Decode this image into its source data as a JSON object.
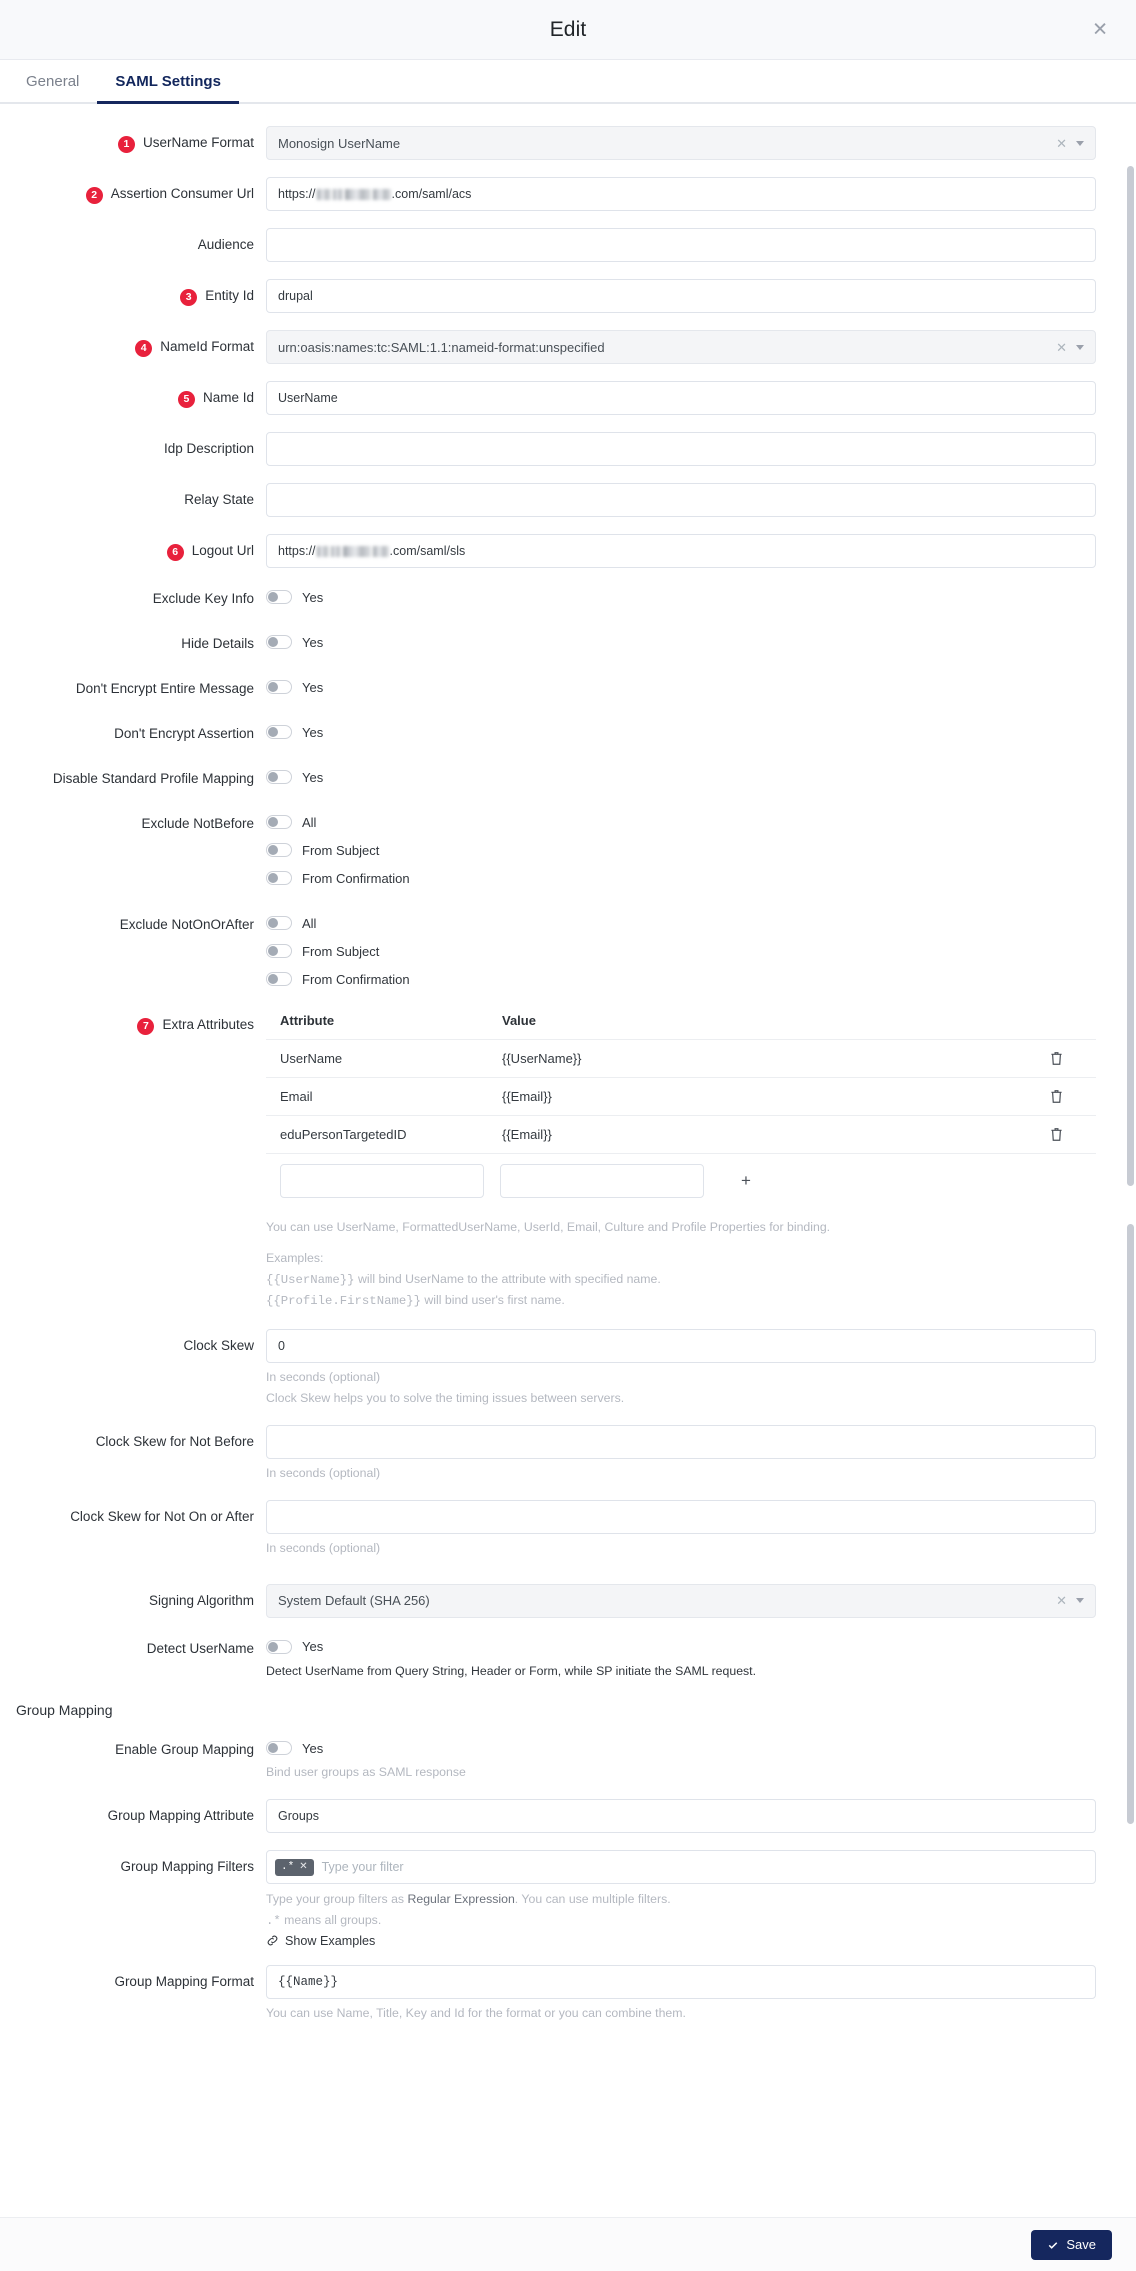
{
  "header": {
    "title": "Edit",
    "close_icon": "close-icon"
  },
  "tabs": [
    {
      "label": "General",
      "active": false
    },
    {
      "label": "SAML Settings",
      "active": true
    }
  ],
  "fields": {
    "username_format": {
      "badge": "1",
      "label": "UserName Format",
      "value": "Monosign UserName"
    },
    "assertion_consumer_url": {
      "badge": "2",
      "label": "Assertion Consumer Url",
      "prefix": "https://",
      "suffix": ".com/saml/acs"
    },
    "audience": {
      "label": "Audience",
      "value": ""
    },
    "entity_id": {
      "badge": "3",
      "label": "Entity Id",
      "value": "drupal"
    },
    "nameid_format": {
      "badge": "4",
      "label": "NameId Format",
      "value": "urn:oasis:names:tc:SAML:1.1:nameid-format:unspecified"
    },
    "name_id": {
      "badge": "5",
      "label": "Name Id",
      "value": "UserName"
    },
    "idp_description": {
      "label": "Idp Description",
      "value": ""
    },
    "relay_state": {
      "label": "Relay State",
      "value": ""
    },
    "logout_url": {
      "badge": "6",
      "label": "Logout Url",
      "prefix": "https://",
      "suffix": ".com/saml/sls"
    },
    "exclude_key_info": {
      "label": "Exclude Key Info",
      "toggle_label": "Yes",
      "on": false
    },
    "hide_details": {
      "label": "Hide Details",
      "toggle_label": "Yes",
      "on": false
    },
    "dont_encrypt_entire_message": {
      "label": "Don't Encrypt Entire Message",
      "toggle_label": "Yes",
      "on": false
    },
    "dont_encrypt_assertion": {
      "label": "Don't Encrypt Assertion",
      "toggle_label": "Yes",
      "on": false
    },
    "disable_standard_profile_mapping": {
      "label": "Disable Standard Profile Mapping",
      "toggle_label": "Yes",
      "on": false
    },
    "exclude_notbefore": {
      "label": "Exclude NotBefore",
      "options": [
        {
          "label": "All",
          "on": false
        },
        {
          "label": "From Subject",
          "on": false
        },
        {
          "label": "From Confirmation",
          "on": false
        }
      ]
    },
    "exclude_notonorafter": {
      "label": "Exclude NotOnOrAfter",
      "options": [
        {
          "label": "All",
          "on": false
        },
        {
          "label": "From Subject",
          "on": false
        },
        {
          "label": "From Confirmation",
          "on": false
        }
      ]
    },
    "extra_attributes": {
      "badge": "7",
      "label": "Extra Attributes",
      "columns": [
        "Attribute",
        "Value"
      ],
      "rows": [
        {
          "attribute": "UserName",
          "value": "{{UserName}}",
          "delete_icon": "trash-icon"
        },
        {
          "attribute": "Email",
          "value": "{{Email}}",
          "delete_icon": "trash-icon"
        },
        {
          "attribute": "eduPersonTargetedID",
          "value": "{{Email}}",
          "delete_icon": "trash-icon"
        }
      ],
      "new_attribute_value": "",
      "new_value_value": "",
      "add_label": "+",
      "hint_binding": "You can use UserName, FormattedUserName, UserId, Email, Culture and Profile Properties for binding.",
      "hint_examples_title": "Examples:",
      "hint_example_1_code": "{{UserName}}",
      "hint_example_1_text": " will bind UserName to the attribute with specified name.",
      "hint_example_2_code": "{{Profile.FirstName}}",
      "hint_example_2_text": " will bind user's first name."
    },
    "clock_skew": {
      "label": "Clock Skew",
      "value": "0",
      "hint_1": "In seconds (optional)",
      "hint_2": "Clock Skew helps you to solve the timing issues between servers."
    },
    "clock_skew_not_before": {
      "label": "Clock Skew for Not Before",
      "value": "",
      "hint_1": "In seconds (optional)"
    },
    "clock_skew_not_on_or_after": {
      "label": "Clock Skew for Not On or After",
      "value": "",
      "hint_1": "In seconds (optional)"
    },
    "signing_algorithm": {
      "label": "Signing Algorithm",
      "value": "System Default (SHA 256)"
    },
    "detect_username": {
      "label": "Detect UserName",
      "toggle_label": "Yes",
      "on": false,
      "hint": "Detect UserName from Query String, Header or Form, while SP initiate the SAML request."
    }
  },
  "group_mapping": {
    "section_title": "Group Mapping",
    "enable": {
      "label": "Enable Group Mapping",
      "toggle_label": "Yes",
      "on": false,
      "hint": "Bind user groups as SAML response"
    },
    "attribute": {
      "label": "Group Mapping Attribute",
      "value": "Groups"
    },
    "filters": {
      "label": "Group Mapping Filters",
      "chips": [
        {
          "text": ".*",
          "remove_icon": "chip-close-icon"
        }
      ],
      "placeholder": "Type your filter",
      "hint_prefix": "Type your group filters as ",
      "hint_strong": "Regular Expression",
      "hint_suffix": ". You can use multiple filters.",
      "hint_line2_code": ".*",
      "hint_line2_text": " means all groups.",
      "show_examples_label": "Show Examples",
      "show_examples_icon": "link-icon"
    },
    "format": {
      "label": "Group Mapping Format",
      "value": "{{Name}}",
      "hint": "You can use Name, Title, Key and Id for the format or you can combine them."
    }
  },
  "footer": {
    "save_label": "Save",
    "save_icon": "check-icon"
  },
  "colors": {
    "accent": "#15275e",
    "badge": "#e8213c",
    "border": "#dfe3ea",
    "muted": "#b4b8c0"
  }
}
